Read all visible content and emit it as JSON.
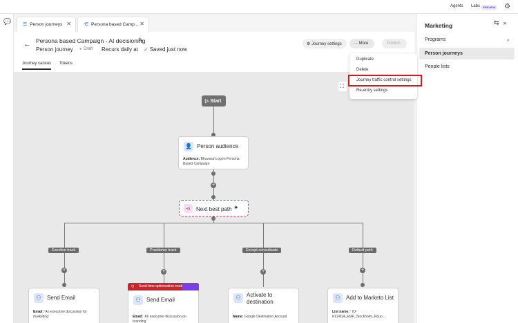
{
  "topbar": {
    "agents": "Agents",
    "labs": "Labs",
    "preview": "PREVIEW"
  },
  "tabs": [
    {
      "label": "Person journeys"
    },
    {
      "label": "Persona based Camp..."
    }
  ],
  "header": {
    "title": "Persona based Campaign - AI decisioning",
    "subtitle": "Person journey",
    "status": "Draft",
    "schedule": "Recurs daily at",
    "saved": "Saved just now",
    "journey_settings": "Journey settings",
    "more": "More",
    "publish": "Publish"
  },
  "subtabs": [
    "Journey canvas",
    "Tokens"
  ],
  "menu": {
    "items": [
      "Duplicate",
      "Delete",
      "Journey traffic control settings",
      "Re-entry settings"
    ]
  },
  "canvas": {
    "start": "Start",
    "audience": {
      "title": "Person audience",
      "desc_label": "Audience:",
      "desc_value": "Bhuvana's pgrm.Persona Based Campaign"
    },
    "next_best_path": "Next best path",
    "paths": [
      "Exective track",
      "Practioner track",
      "Except consultants",
      "Default path"
    ],
    "send_time_badge": "Send-time optimization enabled",
    "cards": [
      {
        "title": "Send Email",
        "desc_label": "Email:",
        "desc_value": "'An executive discussion for marketing'"
      },
      {
        "title": "Send Email",
        "desc_label": "Email:",
        "desc_value": "'An executive discussion on branding'"
      },
      {
        "title": "Activate to destination",
        "desc_label": "Name:",
        "desc_value": "Google Destination Account"
      },
      {
        "title": "Add to Marketo List",
        "desc_label": "List name:",
        "desc_value": "' IO-FY24Q4_EMF_Stockholm_Roun..."
      }
    ]
  },
  "right_panel": {
    "title": "Marketing",
    "items": [
      {
        "label": "Programs"
      },
      {
        "label": "Person journeys"
      },
      {
        "label": "People lists"
      }
    ]
  },
  "colors": {
    "highlight": "#d7191b",
    "accent": "#3b63c4",
    "badge_red": "#c9252c",
    "badge_purple": "#7b3fe4",
    "saved_green": "#2d9d78"
  }
}
